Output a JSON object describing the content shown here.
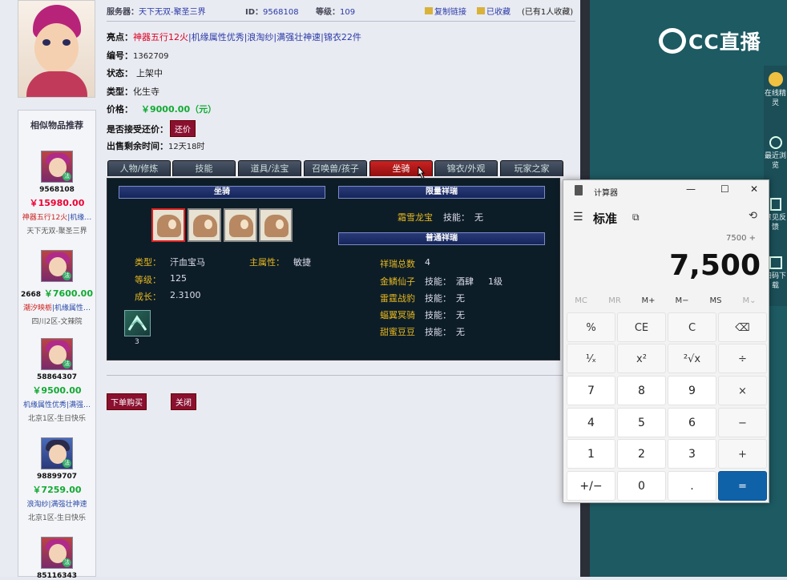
{
  "header": {
    "server_label": "服务器：",
    "server_value": "天下无双-聚圣三界",
    "id_label": "ID：",
    "id_value": "9568108",
    "level_label": "等级：",
    "level_value": "109",
    "copy_link": "复制链接",
    "collected": "已收藏",
    "collect_count": "(已有1人收藏)"
  },
  "details": {
    "highlight_label": "亮点：",
    "highlight_1": "神器五行12火",
    "highlight_2": "|机缘属性优秀|浪淘纱|满强壮神速|锦衣22件",
    "number_label": "编号：",
    "number_value": "1362709",
    "status_label": "状态：",
    "status_value": "上架中",
    "type_label": "类型：",
    "type_value": "化生寺",
    "price_label": "价格：",
    "price_value": "￥9000.00（元）",
    "counter_label": "是否接受还价：",
    "counter_button": "还价",
    "remaining_label": "出售剩余时间：",
    "remaining_value": "12天18时"
  },
  "tabs": [
    "人物/修炼",
    "技能",
    "道具/法宝",
    "召唤兽/孩子",
    "坐骑",
    "锦衣/外观",
    "玩家之家"
  ],
  "panel": {
    "mount_header": "坐骑",
    "limited_header": "限量祥瑞",
    "normal_header": "普通祥瑞",
    "type_label": "类型：",
    "type_value": "汗血宝马",
    "main_attr_label": "主属性：",
    "main_attr_value": "敏捷",
    "level_label": "等级：",
    "level_value": "125",
    "growth_label": "成长：",
    "growth_value": "2.3100",
    "skill_count": "3",
    "limited_name": "霜雪龙宝",
    "skill_label": "技能：",
    "none": "无",
    "total_label": "祥瑞总数",
    "total_value": "4",
    "mounts": [
      {
        "name": "金鳞仙子",
        "skill": "酒肆",
        "lvl": "1级"
      },
      {
        "name": "雷霆战豹",
        "skill": "无",
        "lvl": ""
      },
      {
        "name": "蝠翼冥骑",
        "skill": "无",
        "lvl": ""
      },
      {
        "name": "甜蜜豆豆",
        "skill": "无",
        "lvl": ""
      }
    ]
  },
  "actions": {
    "buy": "下单购买",
    "close": "关闭"
  },
  "similar": {
    "title": "相似物品推荐",
    "items": [
      {
        "id": "9568108",
        "price": "￥15980.00",
        "tag_red": "神器五行12火",
        "tag": "|机缘…",
        "server": "天下无双-聚圣三界",
        "green": false
      },
      {
        "id": "2668",
        "price": "￥7600.00",
        "tag_red": "潮汐映栃",
        "tag": "|机缘属性…",
        "server": "四川2区-文辣院",
        "green": true
      },
      {
        "id": "58864307",
        "price": "￥9500.00",
        "tag_red": "",
        "tag": "机缘属性优秀|满强…",
        "server": "北京1区-生日快乐",
        "green": true
      },
      {
        "id": "98899707",
        "price": "￥7259.00",
        "tag_red": "",
        "tag": "浪淘纱|满强壮神速",
        "server": "北京1区-生日快乐",
        "green": true
      },
      {
        "id": "85116343",
        "price": "",
        "tag_red": "",
        "tag": "",
        "server": "",
        "green": true
      }
    ]
  },
  "stream": {
    "logo": "CC直播",
    "rail": [
      "在线精灵",
      "最近浏览",
      "意见反馈",
      "扫码下载"
    ]
  },
  "calculator": {
    "title": "计算器",
    "mode": "标准",
    "expression": "7500 +",
    "display": "7,500",
    "memory": [
      "MC",
      "MR",
      "M+",
      "M−",
      "MS",
      "M⌄"
    ],
    "keys": [
      [
        "%",
        "CE",
        "C",
        "⌫"
      ],
      [
        "¹⁄ₓ",
        "x²",
        "²√x",
        "÷"
      ],
      [
        "7",
        "8",
        "9",
        "×"
      ],
      [
        "4",
        "5",
        "6",
        "−"
      ],
      [
        "1",
        "2",
        "3",
        "+"
      ],
      [
        "+/−",
        "0",
        ".",
        "="
      ]
    ]
  }
}
